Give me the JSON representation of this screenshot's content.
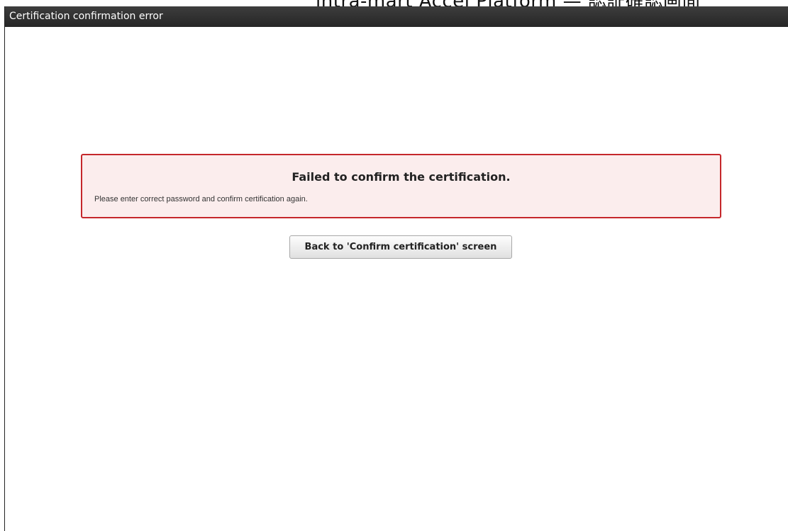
{
  "header_overlay": {
    "text": "intra-mart Accel Platform — 認証確認画面"
  },
  "window": {
    "title": "Certification confirmation error"
  },
  "error_panel": {
    "heading": "Failed to confirm the certification.",
    "message": "Please enter correct password and confirm certification again.",
    "border_color": "#c5272b",
    "background_color": "#fbeded"
  },
  "actions": {
    "back_button_label": "Back to 'Confirm certification' screen"
  }
}
